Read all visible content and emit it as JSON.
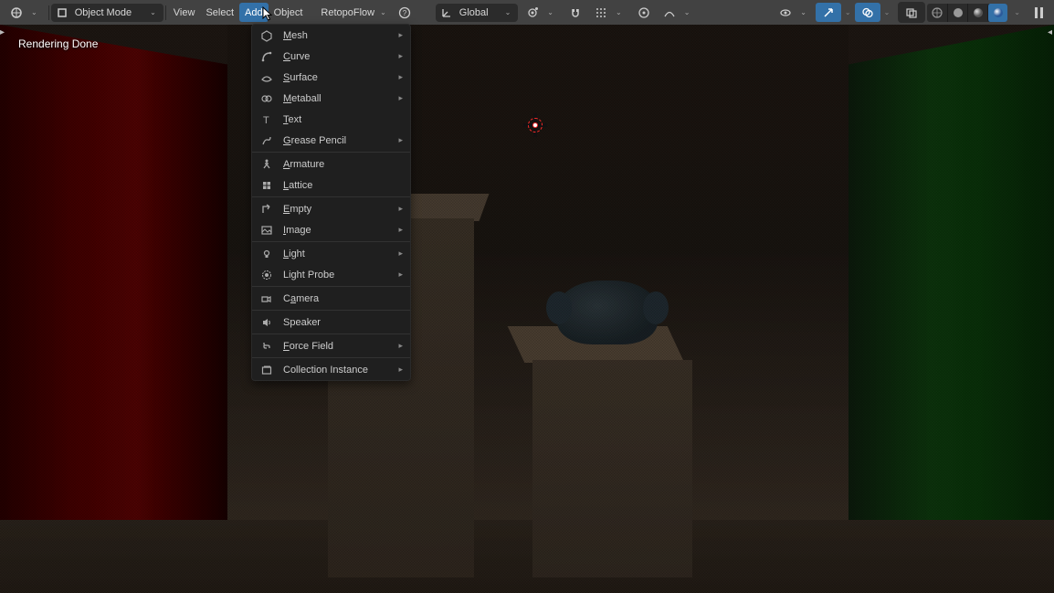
{
  "status_text": "Rendering Done",
  "header": {
    "mode_label": "Object Mode",
    "menus": {
      "view": "View",
      "select": "Select",
      "add": "Add",
      "object": "Object",
      "retopo": "RetopoFlow"
    },
    "orient_label": "Global"
  },
  "add_menu": [
    {
      "icon": "mesh",
      "label": "Mesh",
      "u": "M",
      "sub": true
    },
    {
      "icon": "curve",
      "label": "Curve",
      "u": "C",
      "sub": true
    },
    {
      "icon": "surface",
      "label": "Surface",
      "u": "S",
      "sub": true
    },
    {
      "icon": "meta",
      "label": "Metaball",
      "u": "M",
      "sub": true
    },
    {
      "icon": "text",
      "label": "Text",
      "u": "T",
      "sub": false
    },
    {
      "icon": "gp",
      "label": "Grease Pencil",
      "u": "G",
      "sub": true
    },
    {
      "sep": true
    },
    {
      "icon": "arm",
      "label": "Armature",
      "u": "A",
      "sub": false
    },
    {
      "icon": "lat",
      "label": "Lattice",
      "u": "L",
      "sub": false
    },
    {
      "sep": true
    },
    {
      "icon": "empty",
      "label": "Empty",
      "u": "E",
      "sub": true
    },
    {
      "icon": "img",
      "label": "Image",
      "u": "I",
      "sub": true
    },
    {
      "sep": true
    },
    {
      "icon": "light",
      "label": "Light",
      "u": "L",
      "sub": true
    },
    {
      "icon": "probe",
      "label": "Light Probe",
      "sub": true
    },
    {
      "sep": true
    },
    {
      "icon": "cam",
      "label": "Camera",
      "u": "a",
      "sub": false
    },
    {
      "sep": true
    },
    {
      "icon": "spk",
      "label": "Speaker",
      "sub": false
    },
    {
      "sep": true
    },
    {
      "icon": "ff",
      "label": "Force Field",
      "u": "F",
      "sub": true
    },
    {
      "sep": true
    },
    {
      "icon": "coll",
      "label": "Collection Instance",
      "sub": true
    }
  ]
}
